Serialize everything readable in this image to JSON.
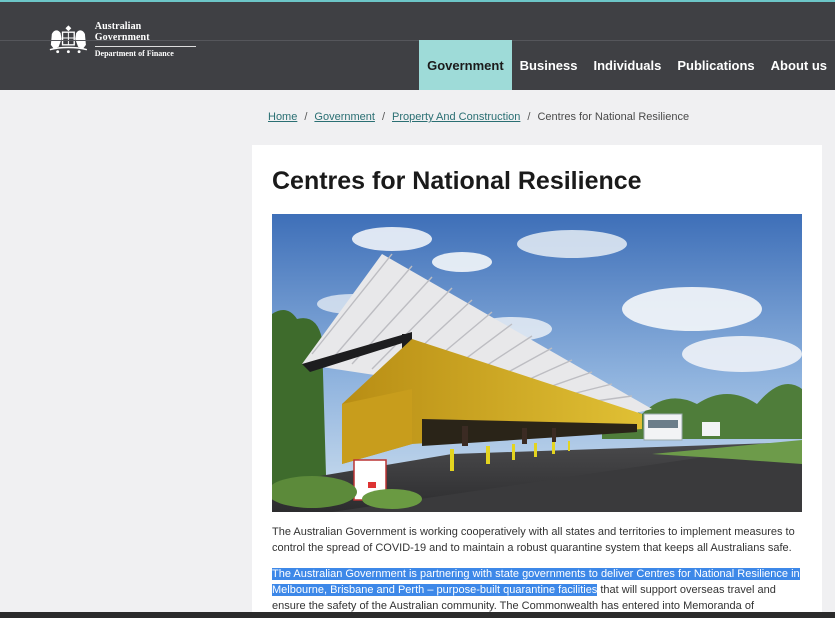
{
  "header": {
    "logo_line1": "Australian Government",
    "logo_line2": "Department of Finance",
    "nav": [
      {
        "label": "Government",
        "active": true
      },
      {
        "label": "Business"
      },
      {
        "label": "Individuals"
      },
      {
        "label": "Publications"
      },
      {
        "label": "About us"
      }
    ]
  },
  "breadcrumb": [
    {
      "label": "Home"
    },
    {
      "label": "Government"
    },
    {
      "label": "Property And Construction"
    },
    {
      "label": "Centres for National Resilience",
      "current": true
    }
  ],
  "page": {
    "title": "Centres for National Resilience",
    "para1": "The Australian Government is working cooperatively with all states and territories to implement measures to control the spread of COVID-19 and to maintain a robust quarantine system that keeps all Australians safe.",
    "para2_highlight": "The Australian Government is partnering with state governments to deliver Centres for National Resilience in Melbourne, Brisbane and Perth – purpose-built quarantine facilities",
    "para2_rest": " that will support overseas travel and ensure the safety of the Australian community. The Commonwealth has entered into Memoranda of Understanding with"
  },
  "colors": {
    "header_bg": "#3f4044",
    "nav_active_bg": "#9edbd8",
    "link": "#2a6f73",
    "selection": "#3d88e8"
  }
}
